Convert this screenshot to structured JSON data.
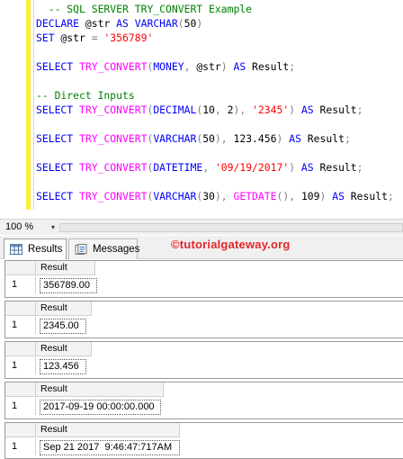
{
  "editor": {
    "lines": [
      [
        {
          "t": "  -- SQL SERVER TRY_CONVERT Example",
          "c": "cm"
        }
      ],
      [
        {
          "t": "DECLARE",
          "c": "kw"
        },
        {
          "t": " @str ",
          "c": ""
        },
        {
          "t": "AS",
          "c": "kw"
        },
        {
          "t": " ",
          "c": ""
        },
        {
          "t": "VARCHAR",
          "c": "kw"
        },
        {
          "t": "(",
          "c": "gr"
        },
        {
          "t": "50",
          "c": ""
        },
        {
          "t": ")",
          "c": "gr"
        }
      ],
      [
        {
          "t": "SET",
          "c": "kw"
        },
        {
          "t": " @str ",
          "c": ""
        },
        {
          "t": "=",
          "c": "gr"
        },
        {
          "t": " ",
          "c": ""
        },
        {
          "t": "'356789'",
          "c": "str"
        }
      ],
      [
        {
          "t": "",
          "c": ""
        }
      ],
      [
        {
          "t": "SELECT",
          "c": "kw"
        },
        {
          "t": " ",
          "c": ""
        },
        {
          "t": "TRY_CONVERT",
          "c": "fn"
        },
        {
          "t": "(",
          "c": "gr"
        },
        {
          "t": "MONEY",
          "c": "kw"
        },
        {
          "t": ", ",
          "c": "gr"
        },
        {
          "t": "@str",
          "c": ""
        },
        {
          "t": ")",
          "c": "gr"
        },
        {
          "t": " ",
          "c": ""
        },
        {
          "t": "AS",
          "c": "kw"
        },
        {
          "t": " Result",
          "c": ""
        },
        {
          "t": ";",
          "c": "gr"
        }
      ],
      [
        {
          "t": "",
          "c": ""
        }
      ],
      [
        {
          "t": "-- Direct Inputs",
          "c": "cm"
        }
      ],
      [
        {
          "t": "SELECT",
          "c": "kw"
        },
        {
          "t": " ",
          "c": ""
        },
        {
          "t": "TRY_CONVERT",
          "c": "fn"
        },
        {
          "t": "(",
          "c": "gr"
        },
        {
          "t": "DECIMAL",
          "c": "kw"
        },
        {
          "t": "(",
          "c": "gr"
        },
        {
          "t": "10",
          "c": ""
        },
        {
          "t": ", ",
          "c": "gr"
        },
        {
          "t": "2",
          "c": ""
        },
        {
          "t": "), ",
          "c": "gr"
        },
        {
          "t": "'2345'",
          "c": "str"
        },
        {
          "t": ")",
          "c": "gr"
        },
        {
          "t": " ",
          "c": ""
        },
        {
          "t": "AS",
          "c": "kw"
        },
        {
          "t": " Result",
          "c": ""
        },
        {
          "t": ";",
          "c": "gr"
        }
      ],
      [
        {
          "t": "",
          "c": ""
        }
      ],
      [
        {
          "t": "SELECT",
          "c": "kw"
        },
        {
          "t": " ",
          "c": ""
        },
        {
          "t": "TRY_CONVERT",
          "c": "fn"
        },
        {
          "t": "(",
          "c": "gr"
        },
        {
          "t": "VARCHAR",
          "c": "kw"
        },
        {
          "t": "(",
          "c": "gr"
        },
        {
          "t": "50",
          "c": ""
        },
        {
          "t": "), ",
          "c": "gr"
        },
        {
          "t": "123.456",
          "c": ""
        },
        {
          "t": ")",
          "c": "gr"
        },
        {
          "t": " ",
          "c": ""
        },
        {
          "t": "AS",
          "c": "kw"
        },
        {
          "t": " Result",
          "c": ""
        },
        {
          "t": ";",
          "c": "gr"
        }
      ],
      [
        {
          "t": "",
          "c": ""
        }
      ],
      [
        {
          "t": "SELECT",
          "c": "kw"
        },
        {
          "t": " ",
          "c": ""
        },
        {
          "t": "TRY_CONVERT",
          "c": "fn"
        },
        {
          "t": "(",
          "c": "gr"
        },
        {
          "t": "DATETIME",
          "c": "kw"
        },
        {
          "t": ", ",
          "c": "gr"
        },
        {
          "t": "'09/19/2017'",
          "c": "str"
        },
        {
          "t": ")",
          "c": "gr"
        },
        {
          "t": " ",
          "c": ""
        },
        {
          "t": "AS",
          "c": "kw"
        },
        {
          "t": " Result",
          "c": ""
        },
        {
          "t": ";",
          "c": "gr"
        }
      ],
      [
        {
          "t": "",
          "c": ""
        }
      ],
      [
        {
          "t": "SELECT",
          "c": "kw"
        },
        {
          "t": " ",
          "c": ""
        },
        {
          "t": "TRY_CONVERT",
          "c": "fn"
        },
        {
          "t": "(",
          "c": "gr"
        },
        {
          "t": "VARCHAR",
          "c": "kw"
        },
        {
          "t": "(",
          "c": "gr"
        },
        {
          "t": "30",
          "c": ""
        },
        {
          "t": "), ",
          "c": "gr"
        },
        {
          "t": "GETDATE",
          "c": "fn"
        },
        {
          "t": "(), ",
          "c": "gr"
        },
        {
          "t": "109",
          "c": ""
        },
        {
          "t": ")",
          "c": "gr"
        },
        {
          "t": " ",
          "c": ""
        },
        {
          "t": "AS",
          "c": "kw"
        },
        {
          "t": " Result",
          "c": ""
        },
        {
          "t": ";",
          "c": "gr"
        }
      ]
    ]
  },
  "status": {
    "zoom": "100 %",
    "zoom_caret": "▾"
  },
  "tabs": [
    {
      "label": "Results",
      "icon": "grid-icon"
    },
    {
      "label": "Messages",
      "icon": "messages-icon"
    }
  ],
  "watermark": "©tutorialgateway.org",
  "grids": [
    {
      "header": "Result",
      "row_number": "1",
      "value": "356789.00"
    },
    {
      "header": "Result",
      "row_number": "1",
      "value": "2345.00"
    },
    {
      "header": "Result",
      "row_number": "1",
      "value": "123.456"
    },
    {
      "header": "Result",
      "row_number": "1",
      "value": "2017-09-19 00:00:00.000"
    },
    {
      "header": "Result",
      "row_number": "1",
      "value": "Sep 21 2017  9:46:47:717AM"
    }
  ],
  "colors": {
    "keyword": "#0000ff",
    "function": "#ff00ff",
    "string": "#ff0000",
    "comment": "#008000",
    "watermark": "#e4262b"
  }
}
